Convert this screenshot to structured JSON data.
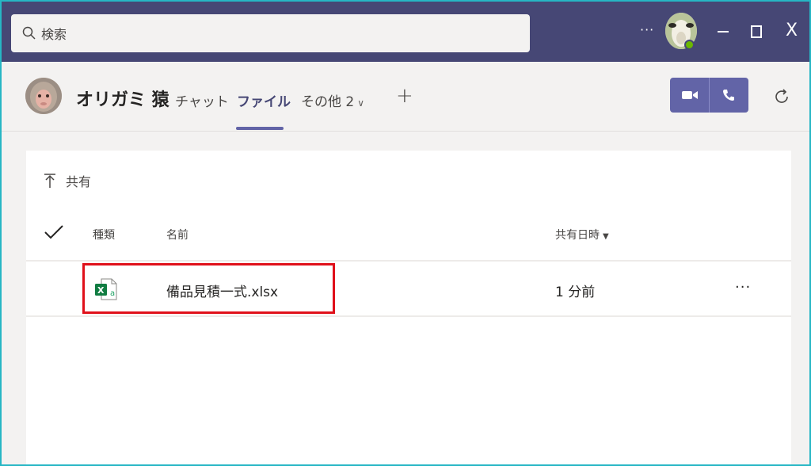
{
  "titlebar": {
    "search_placeholder": "検索",
    "more_label": "···",
    "close_label": "X"
  },
  "header": {
    "chat_name": "オリガミ 猿",
    "tabs": [
      {
        "label": "チャット"
      },
      {
        "label": "ファイル",
        "active": true
      },
      {
        "label": "その他 2"
      }
    ],
    "add_tab_label": "+"
  },
  "files": {
    "breadcrumb": "共有",
    "columns": {
      "type": "種類",
      "name": "名前",
      "shared_time": "共有日時"
    },
    "rows": [
      {
        "icon": "excel-file-icon",
        "name": "備品見積一式.xlsx",
        "shared_time": "1 分前",
        "more": "···"
      }
    ]
  },
  "colors": {
    "titlebar": "#464775",
    "accent": "#6264a7",
    "highlight": "#e0101a",
    "frame": "#26b6c4"
  }
}
